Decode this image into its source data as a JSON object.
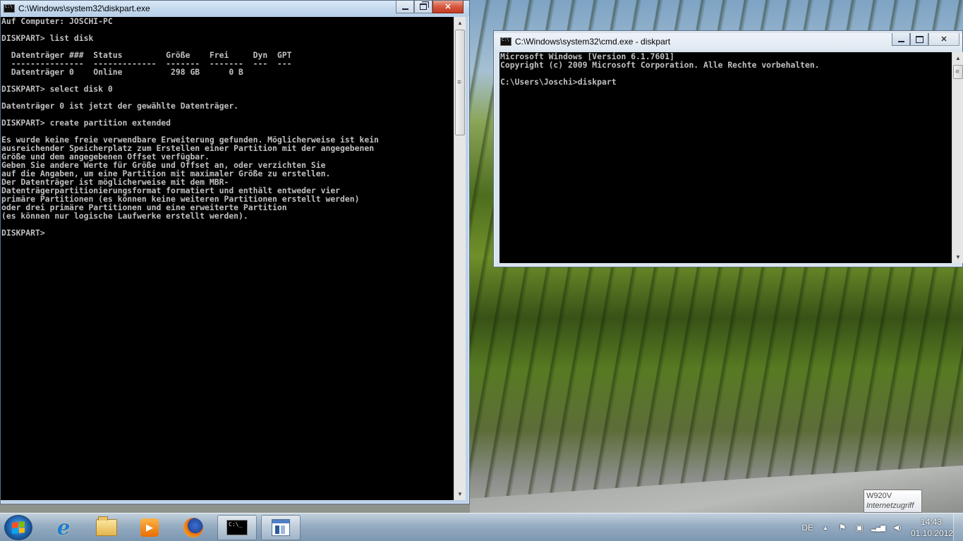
{
  "desktop": {
    "wallpaper_icon": "vineyard-wallpaper"
  },
  "window_diskpart": {
    "title": "C:\\Windows\\system32\\diskpart.exe",
    "console_lines": [
      "Auf Computer: JOSCHI-PC",
      "",
      "DISKPART> list disk",
      "",
      "  Datenträger ###  Status         Größe    Frei     Dyn  GPT",
      "  ---------------  -------------  -------  -------  ---  ---",
      "  Datenträger 0    Online          298 GB      0 B",
      "",
      "DISKPART> select disk 0",
      "",
      "Datenträger 0 ist jetzt der gewählte Datenträger.",
      "",
      "DISKPART> create partition extended",
      "",
      "Es wurde keine freie verwendbare Erweiterung gefunden. Möglicherweise ist kein",
      "ausreichender Speicherplatz zum Erstellen einer Partition mit der angegebenen",
      "Größe und dem angegebenen Offset verfügbar.",
      "Geben Sie andere Werte für Größe und Offset an, oder verzichten Sie",
      "auf die Angaben, um eine Partition mit maximaler Größe zu erstellen.",
      "Der Datenträger ist möglicherweise mit dem MBR-",
      "Datenträgerpartitionierungsformat formatiert und enthält entweder vier",
      "primäre Partitionen (es können keine weiteren Partitionen erstellt werden)",
      "oder drei primäre Partitionen und eine erweiterte Partition",
      "(es können nur logische Laufwerke erstellt werden).",
      "",
      "DISKPART>"
    ]
  },
  "window_cmd": {
    "title": "C:\\Windows\\system32\\cmd.exe - diskpart",
    "console_lines": [
      "Microsoft Windows [Version 6.1.7601]",
      "Copyright (c) 2009 Microsoft Corporation. Alle Rechte vorbehalten.",
      "",
      "C:\\Users\\Joschi>diskpart"
    ]
  },
  "taskbar": {
    "pinned": [
      {
        "name": "internet-explorer-icon",
        "label": "e"
      },
      {
        "name": "explorer-folder-icon"
      },
      {
        "name": "media-player-icon",
        "label": "▶"
      },
      {
        "name": "firefox-icon"
      },
      {
        "name": "cmd-icon",
        "label": "C:\\_"
      },
      {
        "name": "diskpart-icon"
      }
    ],
    "tray": {
      "language": "DE",
      "show_hidden": "▲",
      "icons": [
        "⚑",
        "▣",
        "▂▄▆",
        "◀)"
      ],
      "time": "14:43",
      "date": "01.10.2012"
    }
  },
  "tooltip": {
    "title": "W920V",
    "subtitle": "Internetzugriff"
  }
}
